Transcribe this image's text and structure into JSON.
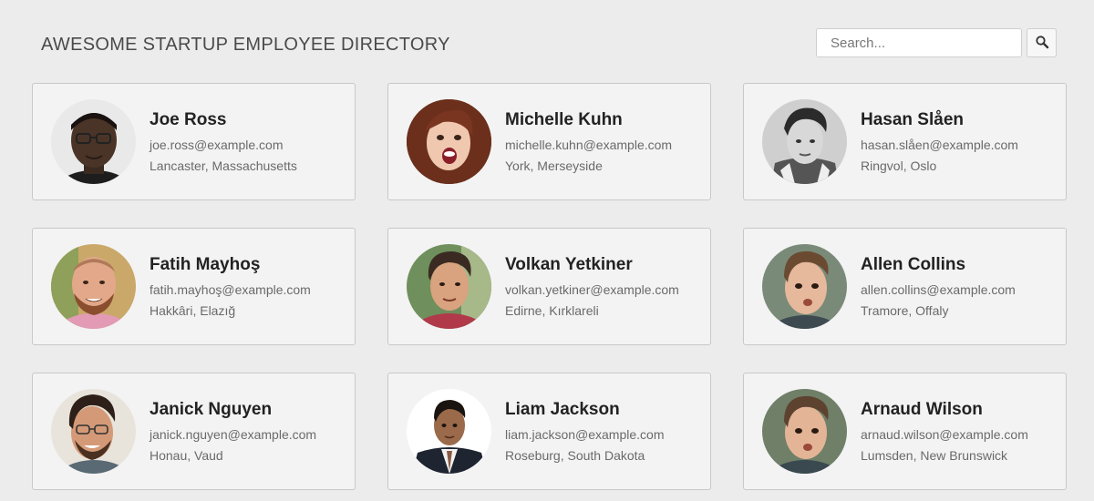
{
  "header": {
    "title": "Awesome Startup Employee Directory"
  },
  "search": {
    "placeholder": "Search...",
    "value": "",
    "button_icon": "magnifier-icon"
  },
  "employees": [
    {
      "name": "Joe Ross",
      "email": "joe.ross@example.com",
      "location": "Lancaster, Massachusetts"
    },
    {
      "name": "Michelle Kuhn",
      "email": "michelle.kuhn@example.com",
      "location": "York, Merseyside"
    },
    {
      "name": "Hasan Slåen",
      "email": "hasan.slåen@example.com",
      "location": "Ringvol, Oslo"
    },
    {
      "name": "Fatih Mayhoş",
      "email": "fatih.mayhoş@example.com",
      "location": "Hakkâri, Elazığ"
    },
    {
      "name": "Volkan Yetkiner",
      "email": "volkan.yetkiner@example.com",
      "location": "Edirne, Kırklareli"
    },
    {
      "name": "Allen Collins",
      "email": "allen.collins@example.com",
      "location": "Tramore, Offaly"
    },
    {
      "name": "Janick Nguyen",
      "email": "janick.nguyen@example.com",
      "location": "Honau, Vaud"
    },
    {
      "name": "Liam Jackson",
      "email": "liam.jackson@example.com",
      "location": "Roseburg, South Dakota"
    },
    {
      "name": "Arnaud Wilson",
      "email": "arnaud.wilson@example.com",
      "location": "Lumsden, New Brunswick"
    }
  ],
  "colors": {
    "background": "#ececec",
    "card_background": "#f3f3f3",
    "card_border": "#c8c8c8",
    "name_text": "#222222",
    "secondary_text": "#6a6a6a"
  }
}
